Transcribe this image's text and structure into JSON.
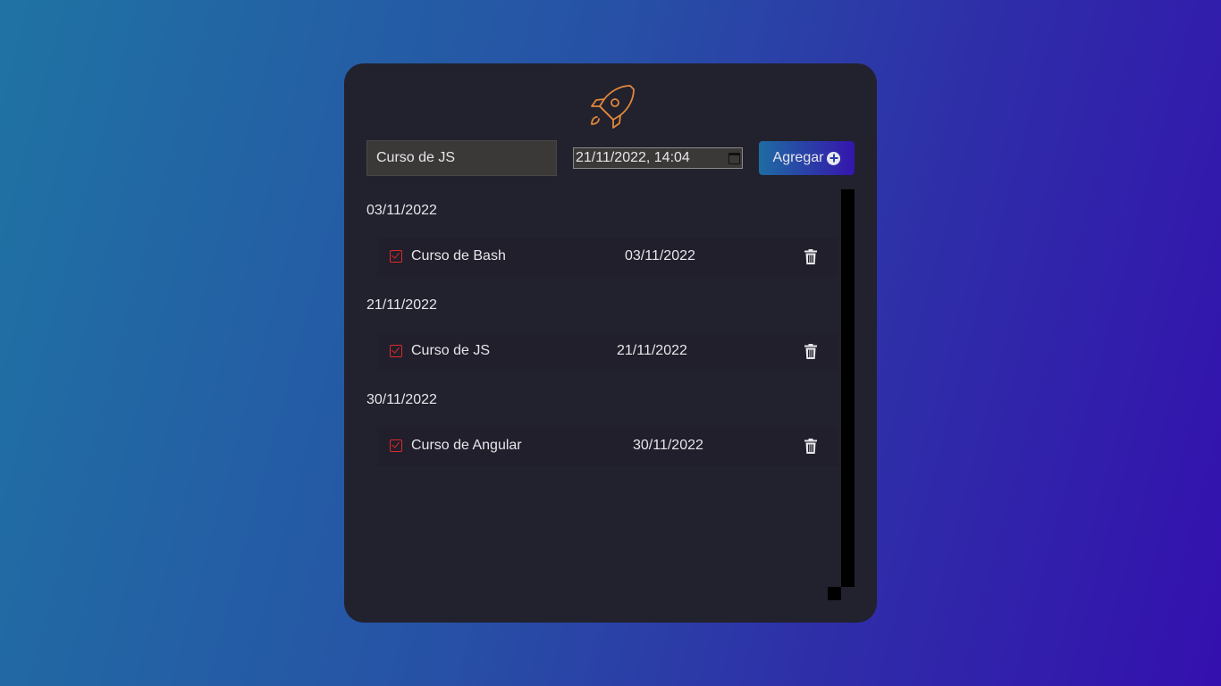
{
  "form": {
    "task_value": "Curso de JS",
    "date_value": "21/11/2022, 14:04",
    "add_label": "Agregar"
  },
  "groups": [
    {
      "date": "03/11/2022",
      "task": {
        "name": "Curso de Bash",
        "date": "03/11/2022",
        "done": true
      }
    },
    {
      "date": "21/11/2022",
      "task": {
        "name": "Curso de JS",
        "date": "21/11/2022",
        "done": true
      }
    },
    {
      "date": "30/11/2022",
      "task": {
        "name": "Curso de Angular",
        "date": "30/11/2022",
        "done": true
      }
    }
  ],
  "colors": {
    "card": "#22212e",
    "logo": "#e0893a",
    "check": "#e02a2a",
    "button_start": "#1e6ca2",
    "button_end": "#3515ad"
  },
  "icons": [
    "rocket-icon",
    "calendar-icon",
    "plus-circle-icon",
    "check-square-icon",
    "trash-icon"
  ]
}
